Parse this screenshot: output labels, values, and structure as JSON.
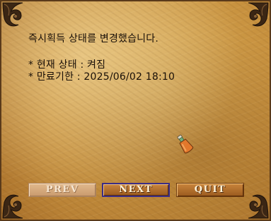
{
  "dialog": {
    "message": "즉시획득 상태를 변경했습니다.",
    "status_line": "* 현재 상태 : 켜짐",
    "expiry_line": "* 만료기한 : 2025/06/02 18:10"
  },
  "buttons": {
    "prev": "PREV",
    "next": "NEXT",
    "quit": "QUIT"
  },
  "icons": {
    "item": "potion-bottle-icon",
    "corner": "ornament-icon"
  },
  "colors": {
    "parchment": "#c8923f",
    "button": "#9a5a1e",
    "next_border": "#3b2d86"
  }
}
